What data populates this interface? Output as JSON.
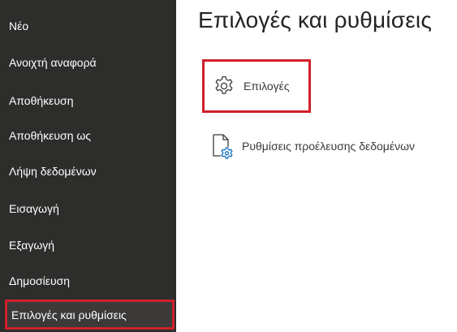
{
  "sidebar": {
    "items": [
      {
        "label": "Νέο"
      },
      {
        "label": "Ανοιχτή αναφορά"
      },
      {
        "label": "Αποθήκευση"
      },
      {
        "label": "Αποθήκευση ως"
      },
      {
        "label": "Λήψη δεδομένων"
      },
      {
        "label": "Εισαγωγή"
      },
      {
        "label": "Εξαγωγή"
      },
      {
        "label": "Δημοσίευση"
      },
      {
        "label": "Επιλογές και ρυθμίσεις",
        "selected": true
      }
    ]
  },
  "main": {
    "title": "Επιλογές και ρυθμίσεις",
    "options": [
      {
        "label": "Επιλογές",
        "icon": "gear-icon",
        "highlighted": true
      },
      {
        "label": "Ρυθμίσεις προέλευσης δεδομένων",
        "icon": "data-source-settings-icon",
        "highlighted": false
      }
    ]
  },
  "colors": {
    "sidebar_bg": "#2d2d2c",
    "highlight_border": "#d0202b",
    "accent_blue": "#0f6cbd"
  }
}
